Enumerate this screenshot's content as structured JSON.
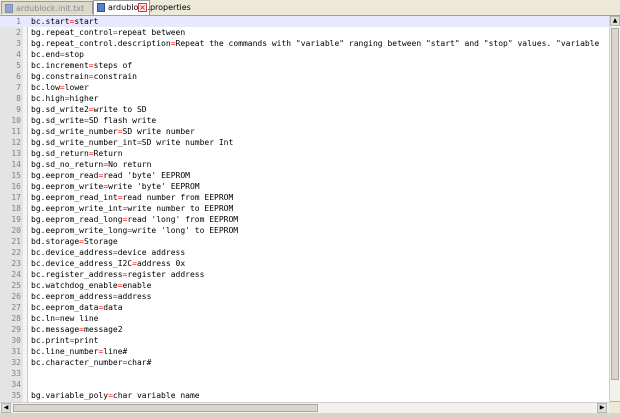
{
  "tabs": [
    {
      "label": "ardublock.init.txt",
      "active": false
    },
    {
      "label": "ardublock.properties",
      "active": true
    }
  ],
  "colors": {
    "key_text": "#000000",
    "equals_sign": "#ff0000",
    "line_numbers": "#808080",
    "current_line": "#e8e8ff"
  },
  "icons": {
    "file": "document-icon",
    "close": "close-icon",
    "scroll_up": "arrow-up-icon",
    "scroll_down": "arrow-down-icon",
    "scroll_left": "arrow-left-icon",
    "scroll_right": "arrow-right-icon"
  },
  "editor": {
    "lines": [
      {
        "num": "1",
        "key": "bc.start",
        "value": "start"
      },
      {
        "num": "2",
        "key": "bg.repeat_control",
        "value": "repeat between"
      },
      {
        "num": "3",
        "key": "bg.repeat_control.description",
        "value": "Repeat the commands with \"variable\" ranging between \"start\" and \"stop\" values. \"variable"
      },
      {
        "num": "4",
        "key": "bc.end",
        "value": "stop"
      },
      {
        "num": "5",
        "key": "bc.increment",
        "value": "steps of"
      },
      {
        "num": "6",
        "key": "bg.constrain",
        "value": "constrain"
      },
      {
        "num": "7",
        "key": "bc.low",
        "value": "lower"
      },
      {
        "num": "8",
        "key": "bc.high",
        "value": "higher"
      },
      {
        "num": "9",
        "key": "bg.sd_write2",
        "value": "write to SD"
      },
      {
        "num": "10",
        "key": "bg.sd_write",
        "value": "SD flash write"
      },
      {
        "num": "11",
        "key": "bg.sd_write_number",
        "value": "SD write number"
      },
      {
        "num": "12",
        "key": "bg.sd_write_number_int",
        "value": "SD write number Int"
      },
      {
        "num": "13",
        "key": "bg.sd_return",
        "value": "Return"
      },
      {
        "num": "14",
        "key": "bg.sd_no_return",
        "value": "No return"
      },
      {
        "num": "15",
        "key": "bg.eeprom_read",
        "value": "read 'byte' EEPROM"
      },
      {
        "num": "16",
        "key": "bg.eeprom_write",
        "value": "write 'byte' EEPROM"
      },
      {
        "num": "17",
        "key": "bg.eeprom_read_int",
        "value": "read number from EEPROM"
      },
      {
        "num": "18",
        "key": "bg.eeprom_write_int",
        "value": "write number to EEPROM"
      },
      {
        "num": "19",
        "key": "bg.eeprom_read_long",
        "value": "read 'long' from EEPROM"
      },
      {
        "num": "20",
        "key": "bg.eeprom_write_long",
        "value": "write 'long' to EEPROM"
      },
      {
        "num": "21",
        "key": "bd.storage",
        "value": "Storage"
      },
      {
        "num": "22",
        "key": "bc.device_address",
        "value": "device address"
      },
      {
        "num": "23",
        "key": "bc.device_address_I2C",
        "value": "address 0x"
      },
      {
        "num": "24",
        "key": "bc.register_address",
        "value": "register address"
      },
      {
        "num": "25",
        "key": "bc.watchdog_enable",
        "value": "enable"
      },
      {
        "num": "26",
        "key": "bc.eeprom_address",
        "value": "address"
      },
      {
        "num": "27",
        "key": "bc.eeprom_data",
        "value": "data"
      },
      {
        "num": "28",
        "key": "bc.ln",
        "value": "new line"
      },
      {
        "num": "29",
        "key": "bc.message",
        "value": "message2"
      },
      {
        "num": "30",
        "key": "bc.print",
        "value": "print"
      },
      {
        "num": "31",
        "key": "bc.line_number",
        "value": "line#"
      },
      {
        "num": "32",
        "key": "bc.character_number",
        "value": "char#"
      },
      {
        "num": "33",
        "key": "",
        "value": ""
      },
      {
        "num": "34",
        "key": "",
        "value": ""
      },
      {
        "num": "35",
        "key": "bg.variable_poly",
        "value": "char variable name"
      }
    ]
  }
}
